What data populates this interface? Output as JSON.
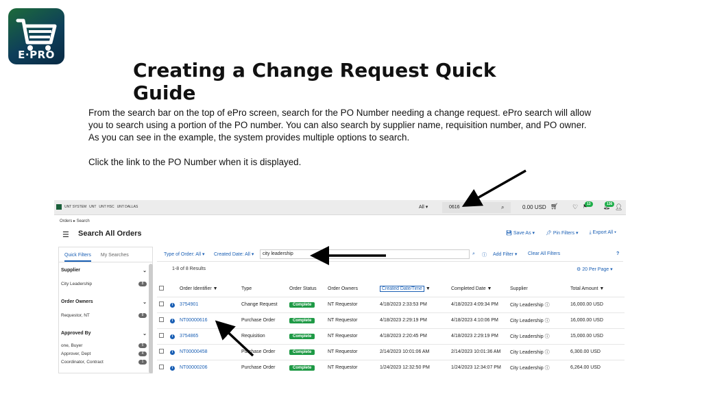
{
  "logo": {
    "text": "E·PRO",
    "icon": "shopping-cart-icon"
  },
  "title": "Creating a Change Request Quick Guide",
  "paragraphs": [
    "From the search bar on the top of ePro screen, search for the PO Number needing a change request. ePro search will allow you to search using a portion of the PO number. You can also search by supplier name, requisition number, and PO owner. As you can see in the example, the system provides multiple options to search.",
    "Click the link to the PO Number when it is displayed."
  ],
  "screenshot": {
    "topbar": {
      "institutions": [
        "UNT SYSTEM",
        "UNT",
        "UNT HSC",
        "UNT DALLAS"
      ],
      "scope": "All",
      "search_value": "0616",
      "cart_amount": "0.00 USD",
      "notif_flag_count": "13",
      "notif_bell_count": "136"
    },
    "breadcrumb": "Orders ▸ Search",
    "page_title": "Search All Orders",
    "actions": [
      "Save As",
      "Pin Filters",
      "Export All"
    ],
    "sidebar": {
      "tabs": [
        "Quick Filters",
        "My Searches"
      ],
      "sections": [
        {
          "head": "Supplier",
          "rows": [
            {
              "label": "City Leadership",
              "count": "8"
            }
          ]
        },
        {
          "head": "Order Owners",
          "rows": [
            {
              "label": "Requestor, NT",
              "count": "8"
            }
          ]
        },
        {
          "head": "Approved By",
          "rows": [
            {
              "label": "one, Buyer",
              "count": "5"
            },
            {
              "label": "Approver, Dept",
              "count": "4"
            },
            {
              "label": "Coordinator, Contract",
              "count": "1"
            }
          ]
        }
      ]
    },
    "filters": {
      "type": "Type of Order: All",
      "created": "Created Date: All",
      "keyword": "city leadership",
      "add": "Add Filter",
      "clear": "Clear All Filters",
      "help": "?"
    },
    "results_text": "1-8 of 8 Results",
    "per_page": "20 Per Page",
    "columns": [
      "Order Identifier",
      "Type",
      "Order Status",
      "Order Owners",
      "Created Date/Time",
      "Completed Date",
      "Supplier",
      "Total Amount"
    ],
    "rows": [
      {
        "id": "3754901",
        "type": "Change Request",
        "status": "Complete",
        "owner": "NT Requestor",
        "created": "4/18/2023  2:33:53 PM",
        "completed": "4/18/2023  4:09:34 PM",
        "supplier": "City Leadership",
        "amount": "16,000.00",
        "currency": "USD"
      },
      {
        "id": "NT00000616",
        "type": "Purchase Order",
        "status": "Complete",
        "owner": "NT Requestor",
        "created": "4/18/2023  2:29:19 PM",
        "completed": "4/18/2023  4:10:06 PM",
        "supplier": "City Leadership",
        "amount": "16,000.00",
        "currency": "USD"
      },
      {
        "id": "3754865",
        "type": "Requisition",
        "status": "Complete",
        "owner": "NT Requestor",
        "created": "4/18/2023  2:20:45 PM",
        "completed": "4/18/2023  2:29:19 PM",
        "supplier": "City Leadership",
        "amount": "15,000.00",
        "currency": "USD"
      },
      {
        "id": "NT00000458",
        "type": "Purchase Order",
        "status": "Complete",
        "owner": "NT Requestor",
        "created": "2/14/2023  10:01:06 AM",
        "completed": "2/14/2023  10:01:36 AM",
        "supplier": "City Leadership",
        "amount": "6,300.00",
        "currency": "USD"
      },
      {
        "id": "NT00000206",
        "type": "Purchase Order",
        "status": "Complete",
        "owner": "NT Requestor",
        "created": "1/24/2023  12:32:50 PM",
        "completed": "1/24/2023  12:34:07 PM",
        "supplier": "City Leadership",
        "amount": "6,264.00",
        "currency": "USD"
      }
    ]
  },
  "colors": {
    "link": "#1a5fb4",
    "status": "#1f9a46",
    "badge": "#1fae4a"
  }
}
